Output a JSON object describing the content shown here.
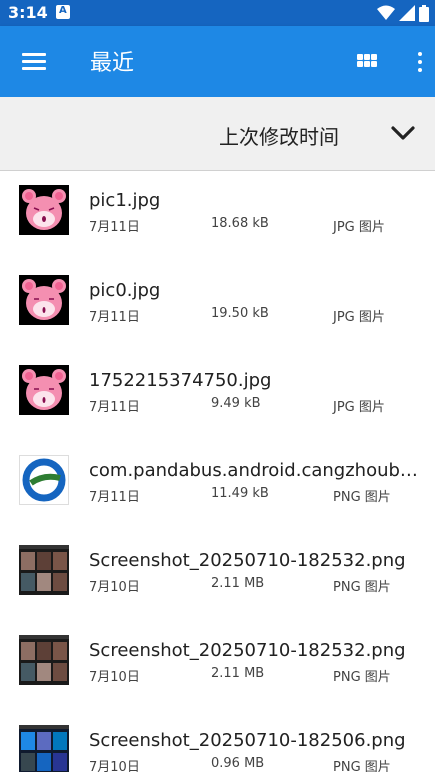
{
  "status_bar": {
    "time": "3:14",
    "notification_letter": "A",
    "icons": [
      "wifi-icon",
      "signal-icon",
      "battery-icon"
    ]
  },
  "app_bar": {
    "title": "最近",
    "menu_icon": "menu-icon",
    "view_icon": "grid-view-icon",
    "more_icon": "more-vert-icon",
    "color": "#1e88e5"
  },
  "sort_bar": {
    "label": "上次修改时间",
    "icon": "chevron-down-icon"
  },
  "files": [
    {
      "name": "pic1.jpg",
      "date": "7月11日",
      "size": "18.68 kB",
      "type": "JPG 图片",
      "thumb": "hamster"
    },
    {
      "name": "pic0.jpg",
      "date": "7月11日",
      "size": "19.50 kB",
      "type": "JPG 图片",
      "thumb": "hamster"
    },
    {
      "name": "1752215374750.jpg",
      "date": "7月11日",
      "size": "9.49 kB",
      "type": "JPG 图片",
      "thumb": "hamster"
    },
    {
      "name": "com.pandabus.android.cangzhoubu…",
      "date": "7月11日",
      "size": "11.49 kB",
      "type": "PNG 图片",
      "thumb": "logo"
    },
    {
      "name": "Screenshot_20250710-182532.png",
      "date": "7月10日",
      "size": "2.11 MB",
      "type": "PNG 图片",
      "thumb": "screenshot"
    },
    {
      "name": "Screenshot_20250710-182532.png",
      "date": "7月10日",
      "size": "2.11 MB",
      "type": "PNG 图片",
      "thumb": "screenshot"
    },
    {
      "name": "Screenshot_20250710-182506.png",
      "date": "7月10日",
      "size": "0.96 MB",
      "type": "PNG 图片",
      "thumb": "screenshot-blue"
    }
  ]
}
